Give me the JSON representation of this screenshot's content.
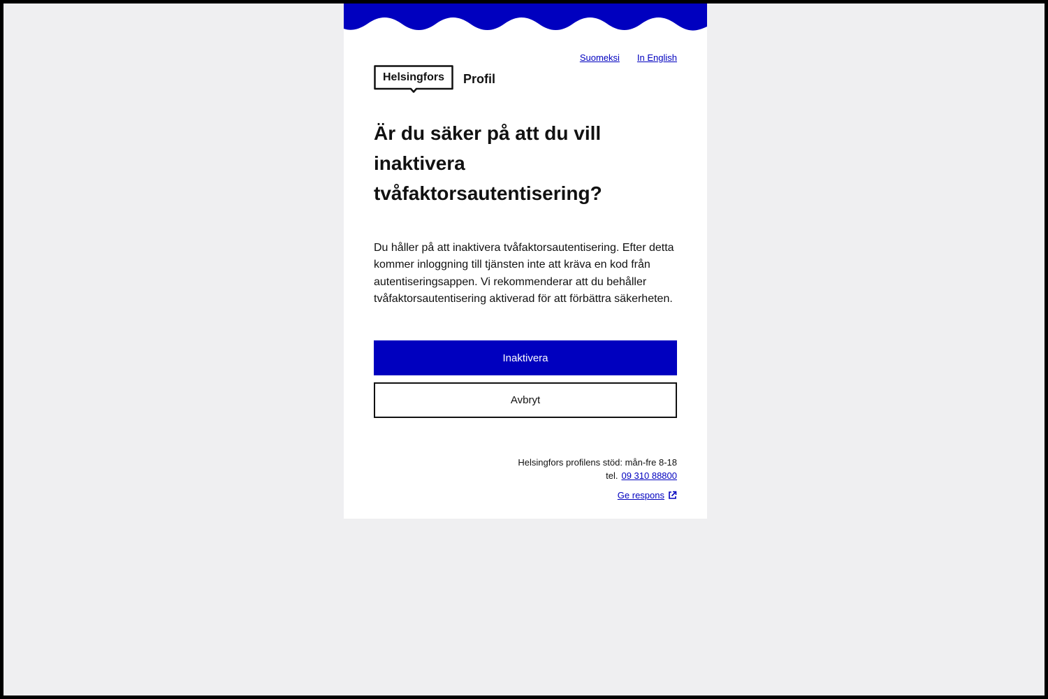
{
  "header": {
    "languages": [
      "Suomeksi",
      "In English"
    ]
  },
  "brand": {
    "logo_text": "Helsingfors",
    "app_name": "Profil"
  },
  "dialog": {
    "title": "Är du säker på att du vill inaktivera tvåfaktorsautentisering?",
    "description": "Du håller på att inaktivera tvåfaktorsautentisering. Efter detta kommer inloggning till tjänsten inte att kräva en kod från autentiseringsappen. Vi rekommenderar att du behåller tvåfaktorsautentisering aktiverad för att förbättra säkerheten.",
    "primary_button": "Inaktivera",
    "secondary_button": "Avbryt"
  },
  "footer": {
    "support_text": "Helsingfors profilens stöd: mån-fre 8-18",
    "phone_label": "tel.",
    "phone_number": "09 310 88800",
    "feedback_link": "Ge respons"
  },
  "colors": {
    "brand_blue": "#0000bf",
    "page_background": "#efeff1",
    "card_background": "#ffffff",
    "text": "#111111"
  },
  "icons": {
    "external_link": "external-link-icon"
  }
}
